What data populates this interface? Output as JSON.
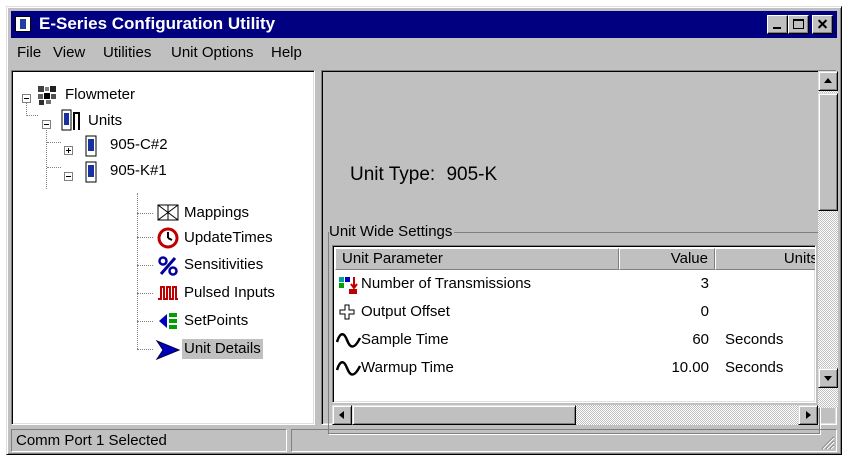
{
  "window": {
    "title": "E-Series Configuration Utility"
  },
  "menu": [
    {
      "label": "File"
    },
    {
      "label": "View"
    },
    {
      "label": "Utilities"
    },
    {
      "label": "Unit Options"
    },
    {
      "label": "Help"
    }
  ],
  "tree": {
    "root": "Flowmeter",
    "units": "Units",
    "unit_a": "905-C#2",
    "unit_b": "905-K#1",
    "children": [
      {
        "label": "Mappings",
        "icon": "mappings-icon"
      },
      {
        "label": "UpdateTimes",
        "icon": "clock-icon"
      },
      {
        "label": "Sensitivities",
        "icon": "percent-icon"
      },
      {
        "label": "Pulsed Inputs",
        "icon": "pulse-icon"
      },
      {
        "label": "SetPoints",
        "icon": "setpoints-icon"
      },
      {
        "label": "Unit Details",
        "icon": "arrow-icon"
      }
    ]
  },
  "details": {
    "unit_type_label": "Unit Type:",
    "unit_type_value": "905-K",
    "group_title": "Unit Wide Settings",
    "columns": [
      "Unit Parameter",
      "Value",
      "Units"
    ],
    "rows": [
      {
        "param": "Number of Transmissions",
        "value": "3",
        "units": "",
        "icon": "transmissions-icon"
      },
      {
        "param": "Output Offset",
        "value": "0",
        "units": "",
        "icon": "plus-icon"
      },
      {
        "param": "Sample Time",
        "value": "60",
        "units": "Seconds",
        "icon": "wave-icon"
      },
      {
        "param": "Warmup Time",
        "value": "10.00",
        "units": "Seconds",
        "icon": "wave-icon"
      }
    ]
  },
  "status": {
    "text": "Comm Port 1 Selected",
    "pane2": ""
  }
}
